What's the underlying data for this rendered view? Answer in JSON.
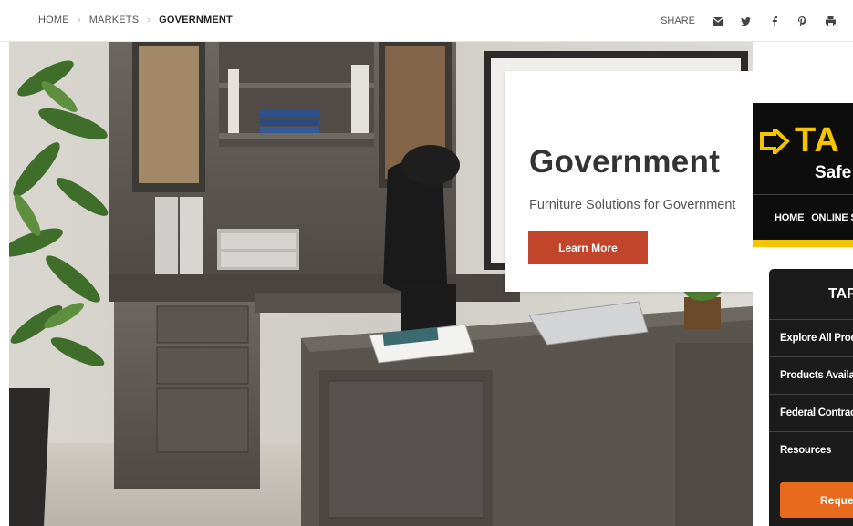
{
  "breadcrumb": {
    "items": [
      {
        "label": "HOME"
      },
      {
        "label": "MARKETS"
      },
      {
        "label": "GOVERNMENT"
      }
    ]
  },
  "share": {
    "label": "SHARE",
    "icons": [
      "email-icon",
      "twitter-icon",
      "facebook-icon",
      "pinterest-icon",
      "print-icon"
    ]
  },
  "promo": {
    "title": "Government",
    "subtitle": "Furniture Solutions for Government",
    "button_label": "Learn More",
    "button_color": "#c0452a"
  },
  "side_ad": {
    "logo_text": "TA",
    "tagline": "Safe",
    "nav": [
      "HOME",
      "ONLINE ST"
    ],
    "panel_title": "TAP",
    "panel_items": [
      "Explore All Produ",
      "Products Availabl",
      "Federal Contracts",
      "Resources"
    ],
    "cta_label": "Request",
    "accent_color": "#f5c400",
    "cta_color": "#e86a1c"
  }
}
